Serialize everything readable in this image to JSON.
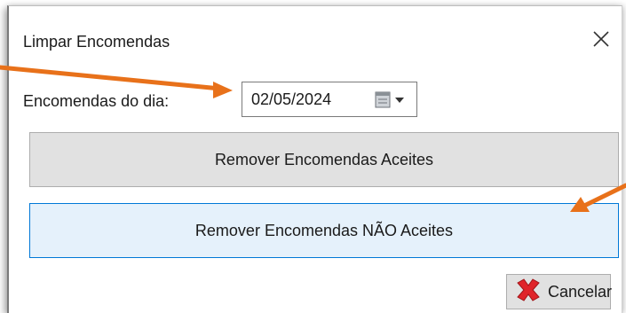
{
  "dialog": {
    "title": "Limpar Encomendas",
    "close_icon": "close-icon"
  },
  "date_filter": {
    "label": "Encomendas do dia:",
    "value": "02/05/2024",
    "dropdown_icon": "calendar-dropdown-icon"
  },
  "buttons": {
    "remove_accepted": "Remover Encomendas Aceites",
    "remove_not_accepted": "Remover Encomendas NÃO Aceites",
    "cancel": "Cancelar",
    "cancel_icon": "red-x-icon"
  },
  "colors": {
    "annotation_arrow": "#e8711a",
    "focused_button_bg": "#e5f1fb",
    "focused_button_border": "#0078d7",
    "cancel_icon": "#e0242a"
  }
}
